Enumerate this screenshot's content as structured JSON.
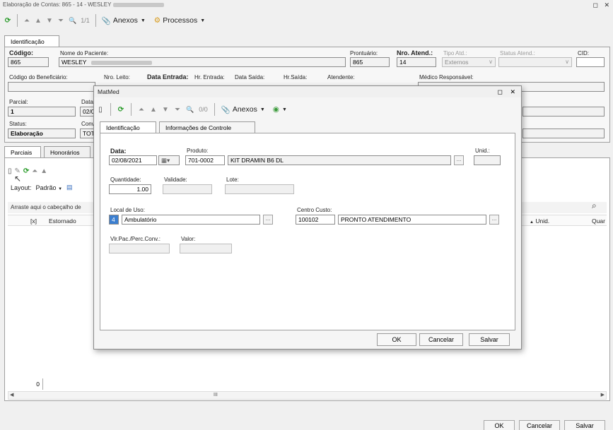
{
  "window": {
    "title": "Elaboração de Contas: 865 - 14 - WESLEY",
    "controls": "◻ ✕"
  },
  "toolbar": {
    "refresh": "⟳",
    "first": "⏶",
    "prev": "▲",
    "next": "▼",
    "last": "⏷",
    "search": "🔍",
    "record_count": "1/1",
    "anexos_label": "Anexos",
    "processos_label": "Processos"
  },
  "tabs": {
    "identificacao": "Identificação"
  },
  "header_form": {
    "codigo_label": "Código:",
    "codigo_value": "865",
    "paciente_label": "Nome do Paciente:",
    "paciente_value": "WESLEY",
    "prontuario_label": "Prontuário:",
    "prontuario_value": "865",
    "nro_atend_label": "Nro. Atend.:",
    "nro_atend_value": "14",
    "tipo_atd_label": "Tipo Atd.:",
    "tipo_atd_value": "Externos",
    "status_atend_label": "Status Atend.:",
    "cid_label": "CID:",
    "beneficiario_label": "Código do Beneficiário:",
    "nro_leito_label": "Nro. Leito:",
    "data_entrada_label": "Data Entrada:",
    "hr_entrada_label": "Hr. Entrada:",
    "data_saida_label": "Data Saída:",
    "hr_saida_label": "Hr.Saída:",
    "atendente_label": "Atendente:",
    "medico_label": "Médico Responsável:",
    "parcial_label": "Parcial:",
    "parcial_value": "1",
    "data_label_partial": "Data",
    "data_value_partial": "02/0",
    "status_label": "Status:",
    "status_value": "Elaboração",
    "conv_label": "Conv",
    "conv_value": "TOT"
  },
  "lower_tabs": {
    "parciais": "Parciais",
    "honorarios": "Honorários"
  },
  "lower": {
    "layout_label": "Layout:",
    "padrao_label": "Padrão",
    "grouping_hint": "Arraste aqui o cabeçalho de",
    "col_x": "[x]",
    "col_estornado": "Estornado",
    "col_unid": "Unid.",
    "col_quar": "Quar",
    "count": "0",
    "scroll_mid": "III"
  },
  "bottom_buttons": {
    "ok": "OK",
    "cancelar": "Cancelar",
    "salvar": "Salvar"
  },
  "dialog": {
    "title": "MatMed",
    "controls": "◻ ✕",
    "record_count": "0/0",
    "anexos_label": "Anexos",
    "tabs": [
      "Identificação",
      "Informações de Controle"
    ],
    "data_label": "Data:",
    "data_value": "02/08/2021",
    "produto_label": "Produto:",
    "produto_code": "701-0002",
    "produto_name": "KIT DRAMIN B6 DL",
    "unid_label": "Unid.:",
    "quantidade_label": "Quantidade:",
    "quantidade_value": "1.00",
    "validade_label": "Validade:",
    "lote_label": "Lote:",
    "local_uso_label": "Local de Uso:",
    "local_uso_code": "4",
    "local_uso_name": "Ambulatório",
    "centro_custo_label": "Centro Custo:",
    "centro_custo_code": "100102",
    "centro_custo_name": "PRONTO ATENDIMENTO",
    "vlr_pac_label": "Vlr.Pac./Perc.Conv.:",
    "valor_label": "Valor:",
    "ok": "OK",
    "cancelar": "Cancelar",
    "salvar": "Salvar",
    "ellipsis": "..."
  }
}
